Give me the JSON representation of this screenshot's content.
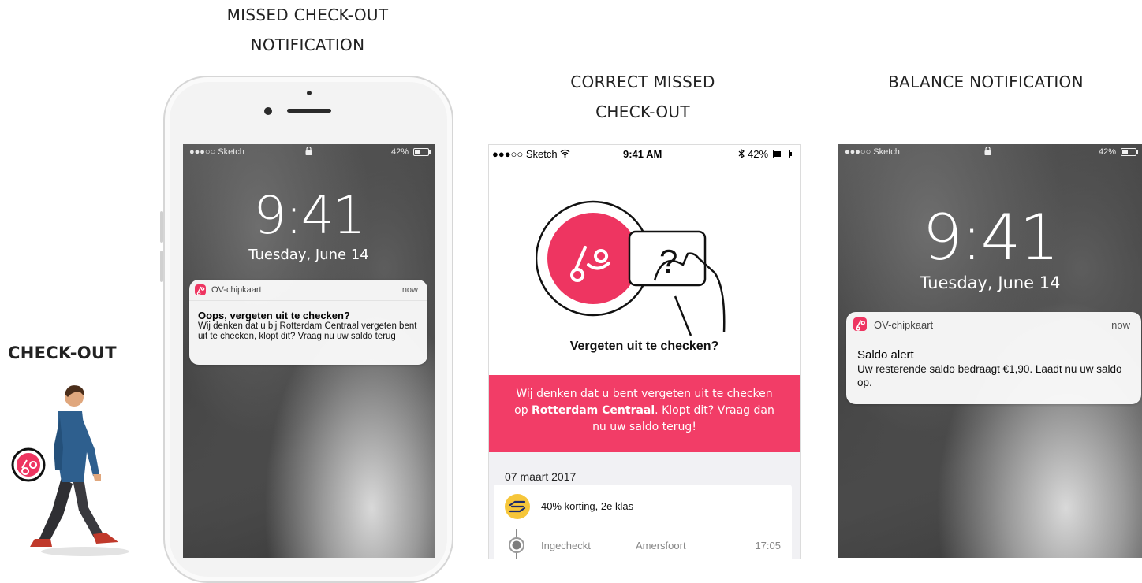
{
  "headings": {
    "missed_line1": "MISSED CHECK-OUT",
    "missed_line2": "NOTIFICATION",
    "correct_line1": "CORRECT MISSED",
    "correct_line2": "CHECK-OUT",
    "balance": "BALANCE NOTIFICATION",
    "checkout": "CHECK-OUT"
  },
  "colors": {
    "accent": "#ee3561",
    "banner": "#f23d67",
    "ns_yellow": "#f6c63a"
  },
  "lock1": {
    "carrier": "●●●○○ Sketch",
    "battery": "42%",
    "time": "9:41",
    "date": "Tuesday, June 14",
    "notification": {
      "app": "OV-chipkaart",
      "when": "now",
      "title": "Oops, vergeten uit te checken?",
      "body": "Wij denken dat u bij Rotterdam Centraal vergeten bent uit te checken, klopt dit? Vraag nu uw saldo terug"
    }
  },
  "app": {
    "carrier": "●●●○○ Sketch",
    "clock": "9:41 AM",
    "battery": "42%",
    "hero_title": "Vergeten uit te checken?",
    "question_mark": "?",
    "banner_pre": "Wij denken dat u bent vergeten uit te checken op ",
    "banner_station": "Rotterdam Centraal",
    "banner_post": ". Klopt dit? Vraag dan nu uw saldo terug!",
    "trip_date": "07 maart 2017",
    "discount": "40% korting, 2e klas",
    "row_status": "Ingecheckt",
    "row_station": "Amersfoort",
    "row_time": "17:05"
  },
  "lock2": {
    "carrier": "●●●○○ Sketch",
    "battery": "42%",
    "time": "9:41",
    "date": "Tuesday, June 14",
    "notification": {
      "app": "OV-chipkaart",
      "when": "now",
      "title": "Saldo alert",
      "body": "Uw resterende saldo bedraagt €1,90. Laadt nu uw saldo op."
    }
  },
  "icons": [
    "ov-chipkaart-logo-icon",
    "lock-icon",
    "battery-icon",
    "wifi-icon",
    "bluetooth-icon",
    "ns-logo-icon",
    "hand-card-icon",
    "timeline-dot-icon",
    "person-walking-illustration"
  ]
}
